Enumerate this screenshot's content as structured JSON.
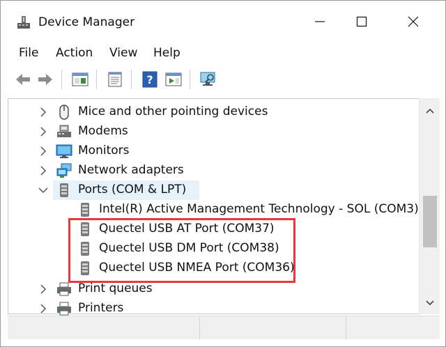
{
  "window": {
    "title": "Device Manager",
    "icon": "device-manager-icon"
  },
  "titlebar_buttons": {
    "minimize": "minimize-icon",
    "maximize": "maximize-icon",
    "close": "close-icon"
  },
  "menu": {
    "items": [
      {
        "label": "File"
      },
      {
        "label": "Action"
      },
      {
        "label": "View"
      },
      {
        "label": "Help"
      }
    ]
  },
  "toolbar": {
    "buttons": [
      "back-arrow-icon",
      "forward-arrow-icon",
      "show-hide-console-tree-icon",
      "properties-icon",
      "help-icon",
      "action-pane-icon",
      "scan-hardware-changes-icon"
    ]
  },
  "tree": {
    "nodes": [
      {
        "label": "Mice and other pointing devices",
        "icon": "mouse-icon",
        "expander": "collapsed"
      },
      {
        "label": "Modems",
        "icon": "modem-icon",
        "expander": "collapsed"
      },
      {
        "label": "Monitors",
        "icon": "monitor-icon",
        "expander": "collapsed"
      },
      {
        "label": "Network adapters",
        "icon": "network-adapter-icon",
        "expander": "collapsed"
      },
      {
        "label": "Ports (COM & LPT)",
        "icon": "port-icon",
        "expander": "expanded",
        "selected": true
      },
      {
        "label": "Intel(R) Active Management Technology - SOL (COM3)",
        "icon": "port-icon",
        "child": true
      },
      {
        "label": "Quectel USB AT Port (COM37)",
        "icon": "port-icon",
        "child": true
      },
      {
        "label": "Quectel USB DM Port (COM38)",
        "icon": "port-icon",
        "child": true
      },
      {
        "label": "Quectel USB NMEA Port (COM36)",
        "icon": "port-icon",
        "child": true
      },
      {
        "label": "Print queues",
        "icon": "printer-icon",
        "expander": "collapsed"
      },
      {
        "label": "Printers",
        "icon": "printer-icon",
        "expander": "collapsed"
      }
    ]
  },
  "colors": {
    "highlight": "#e8383c",
    "selection": "#e5f1fb",
    "help_blue": "#2b5fb4"
  }
}
